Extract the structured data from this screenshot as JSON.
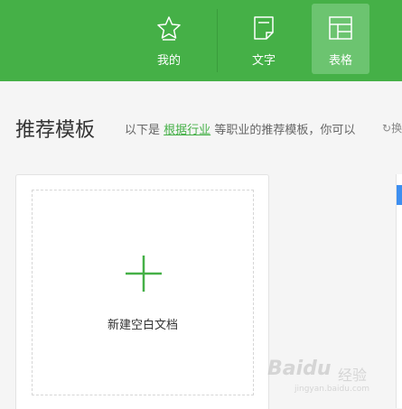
{
  "nav": {
    "items": [
      {
        "label": "我的",
        "icon": "star-icon"
      },
      {
        "label": "文字",
        "icon": "document-icon"
      },
      {
        "label": "表格",
        "icon": "table-icon",
        "active": true
      }
    ]
  },
  "main": {
    "title": "推荐模板",
    "hint_prefix": "以下是",
    "hint_link": "根据行业",
    "hint_suffix": "等职业的推荐模板，你可以",
    "refresh_label": "换"
  },
  "new_card": {
    "label": "新建空白文档",
    "icon": "plus-icon"
  },
  "watermark": {
    "brand": "Baidu",
    "suffix": "经验",
    "url": "jingyan.baidu.com"
  },
  "colors": {
    "brand_green": "#45b047",
    "active_tab": "#6cc470",
    "accent_blue": "#3d8ff0"
  }
}
